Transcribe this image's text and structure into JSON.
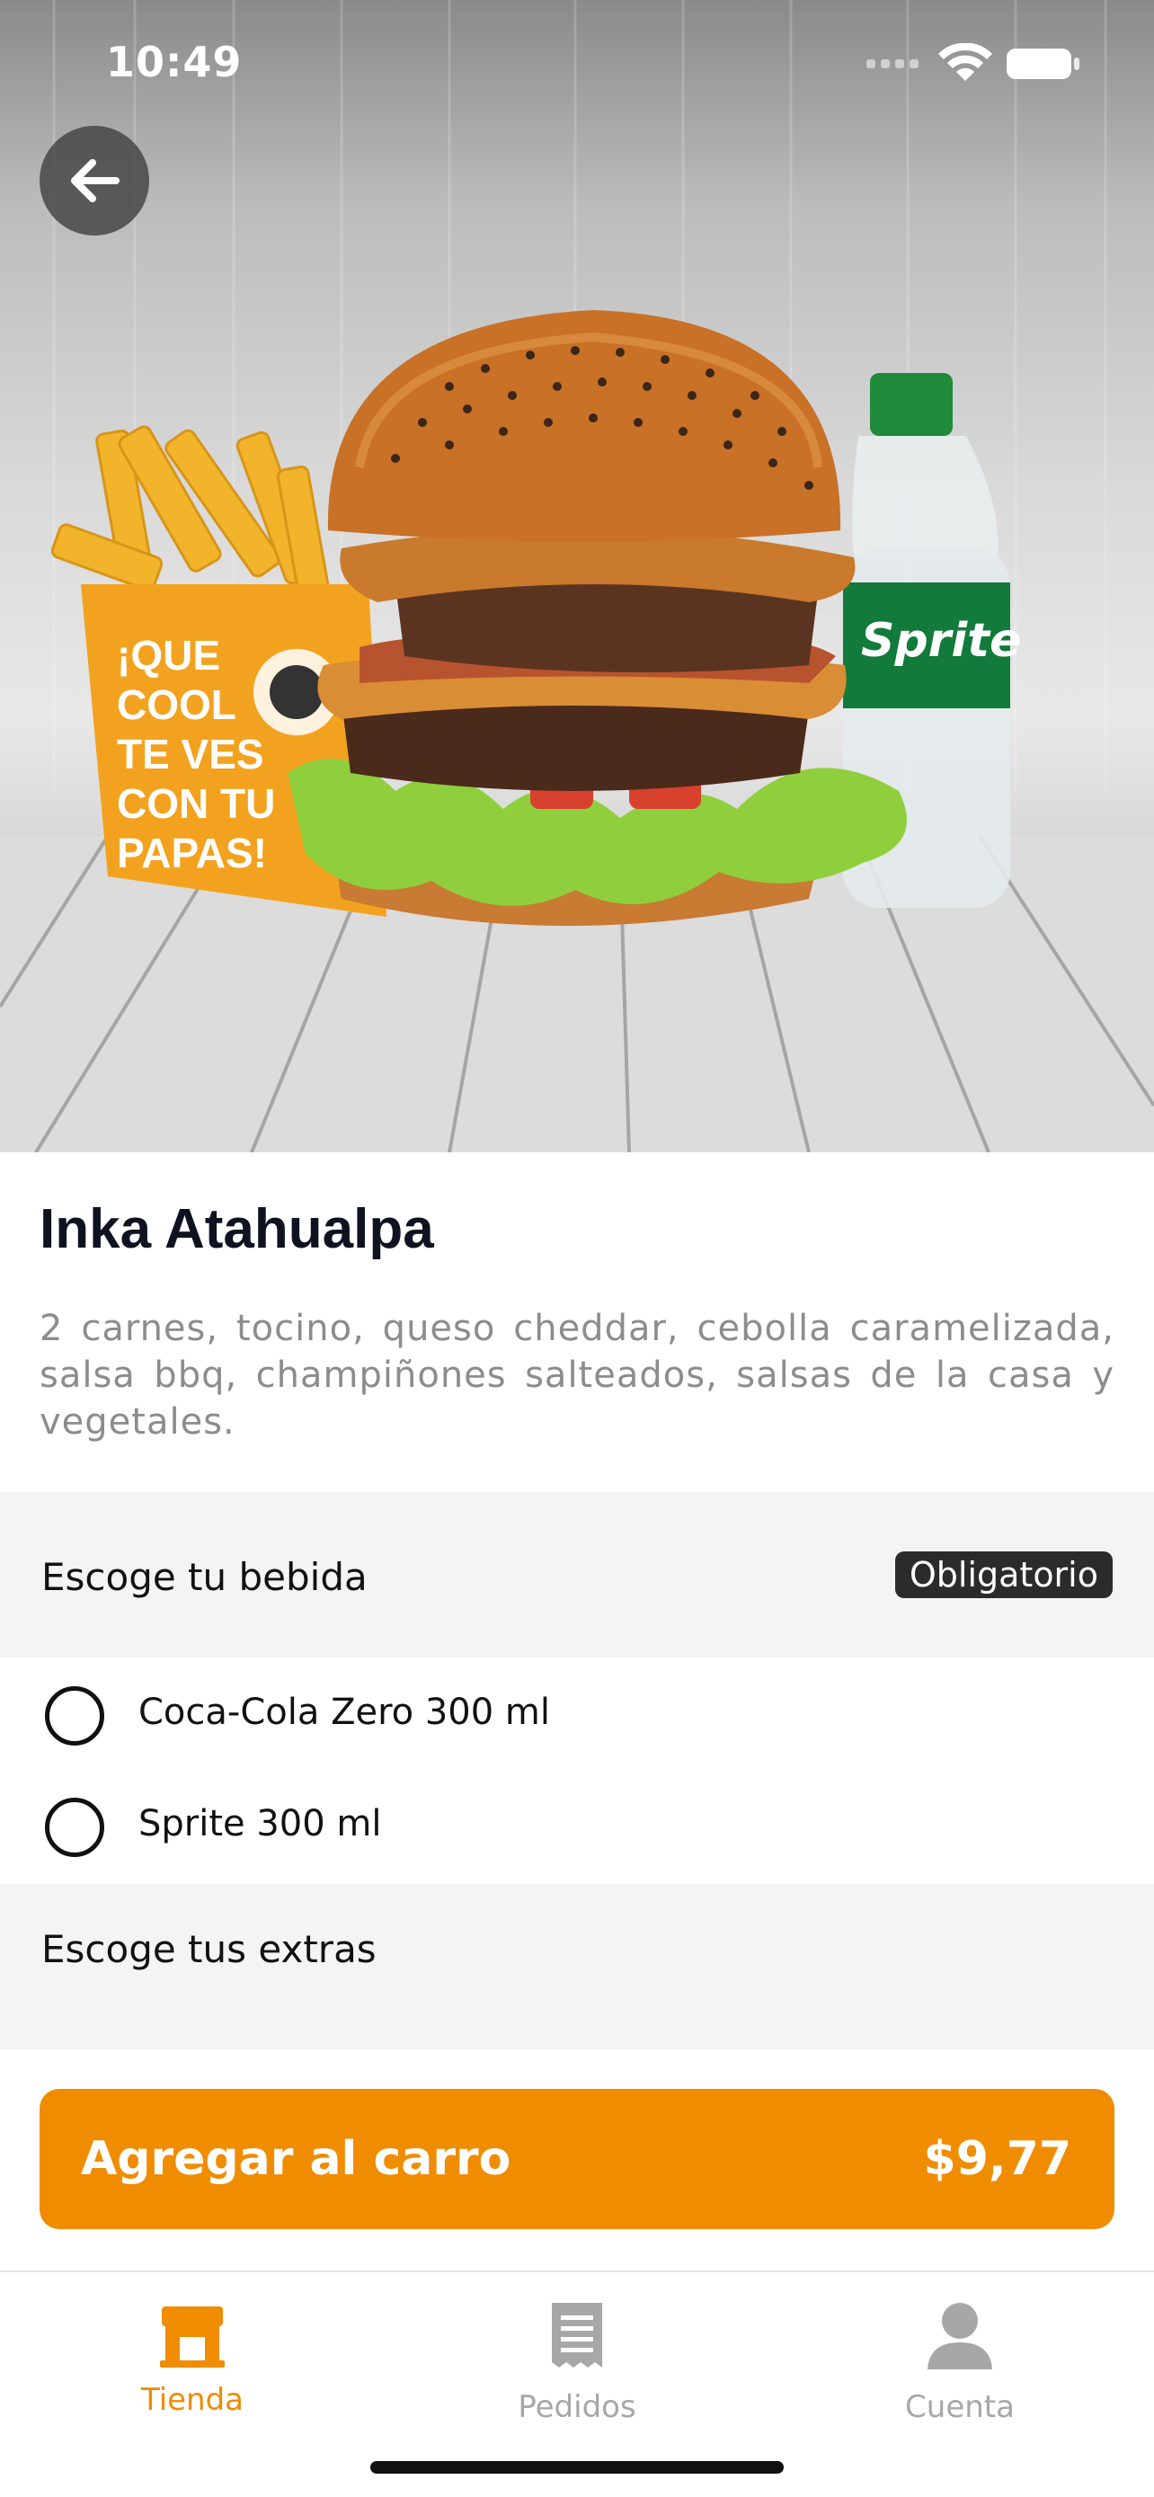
{
  "status_bar": {
    "time": "10:49"
  },
  "hero": {
    "image_alt": "burger-combo-photo"
  },
  "product": {
    "title": "Inka Atahualpa",
    "description": "2 carnes, tocino, queso cheddar, cebolla caramelizada, salsa bbq, champiñones salteados, salsas de la casa y vegetales."
  },
  "drink_section": {
    "label": "Escoge tu bebida",
    "badge": "Obligatorio",
    "options": [
      {
        "label": "Coca-Cola Zero 300 ml",
        "selected": false
      },
      {
        "label": "Sprite 300 ml",
        "selected": false
      }
    ]
  },
  "extras_section": {
    "label": "Escoge tus extras"
  },
  "cta": {
    "label": "Agregar al carro",
    "price": "$9,77"
  },
  "tabs": [
    {
      "label": "Tienda",
      "icon": "store-icon",
      "active": true
    },
    {
      "label": "Pedidos",
      "icon": "receipt-icon",
      "active": false
    },
    {
      "label": "Cuenta",
      "icon": "person-icon",
      "active": false
    }
  ],
  "colors": {
    "accent": "#f08c00",
    "badge_bg": "#2b2b2b",
    "section_bg": "#f4f4f4",
    "title": "#0f1220"
  }
}
